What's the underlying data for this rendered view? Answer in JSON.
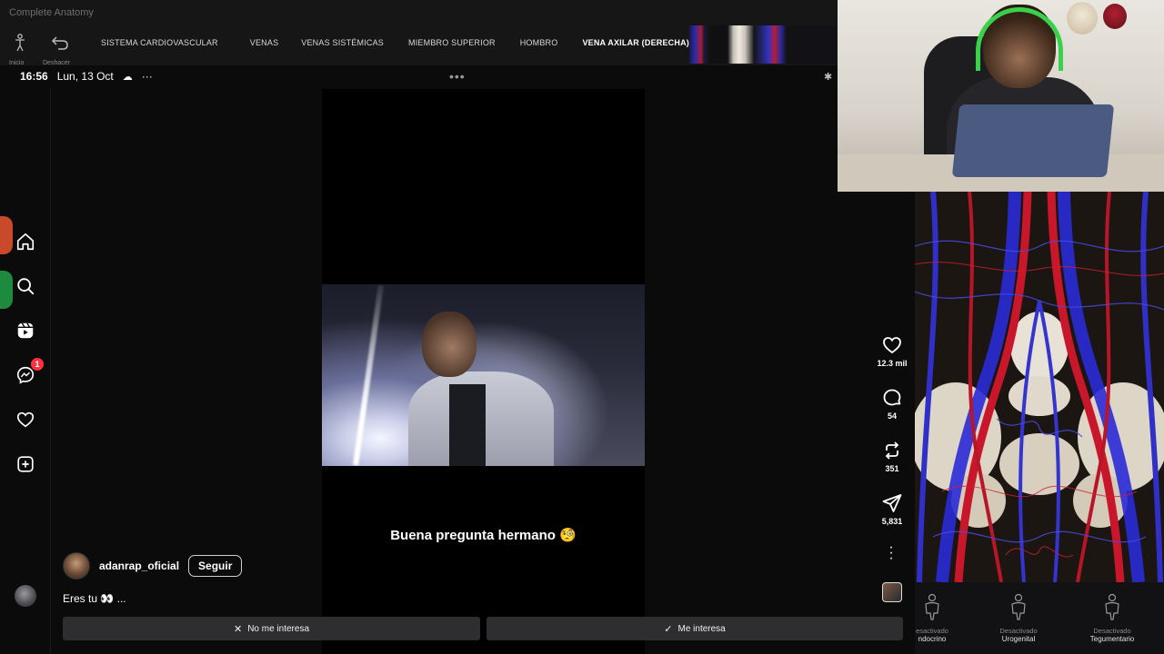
{
  "anatomy_app": {
    "title": "Complete Anatomy",
    "tools": [
      {
        "icon": "human-figure-icon",
        "label": "Inicio"
      },
      {
        "icon": "undo-icon",
        "label": "Deshacer"
      }
    ],
    "breadcrumbs": [
      "SISTEMA CARDIOVASCULAR",
      "VENAS",
      "VENAS SISTÉMICAS",
      "MIEMBRO SUPERIOR",
      "HOMBRO",
      "VENA AXILAR (DERECHA)"
    ],
    "systems": [
      {
        "status": "Desactivado",
        "name": "Endocrino",
        "display_name": "ndocrino",
        "display_status": "esactivado"
      },
      {
        "status": "Desactivado",
        "name": "Urogenital"
      },
      {
        "status": "Desactivado",
        "name": "Tegumentario"
      }
    ]
  },
  "status_bar": {
    "time": "16:56",
    "date": "Lun, 13 Oct",
    "extra": "···",
    "center_dots": "•••"
  },
  "sidebar": {
    "items": [
      {
        "icon": "home-icon"
      },
      {
        "icon": "search-icon"
      },
      {
        "icon": "reels-icon"
      },
      {
        "icon": "messenger-icon",
        "badge": "1"
      },
      {
        "icon": "heart-icon"
      },
      {
        "icon": "create-icon"
      },
      {
        "icon": "profile-avatar-icon"
      }
    ]
  },
  "reel": {
    "caption": "Buena pregunta hermano 🧐",
    "author": "adanrap_oficial",
    "follow_label": "Seguir",
    "description": "Eres tu 👀 ...",
    "actions": [
      {
        "icon": "like-heart-icon",
        "count": "12.3 mil"
      },
      {
        "icon": "comment-icon",
        "count": "54"
      },
      {
        "icon": "repost-icon",
        "count": "351"
      },
      {
        "icon": "share-icon",
        "count": "5,831"
      }
    ],
    "not_interested_label": "No me interesa",
    "interested_label": "Me interesa"
  },
  "colors": {
    "badge": "#ff3040",
    "vein_blue": "#2b2bd0",
    "artery_red": "#c0182a",
    "headset_green": "#3ad14a"
  }
}
